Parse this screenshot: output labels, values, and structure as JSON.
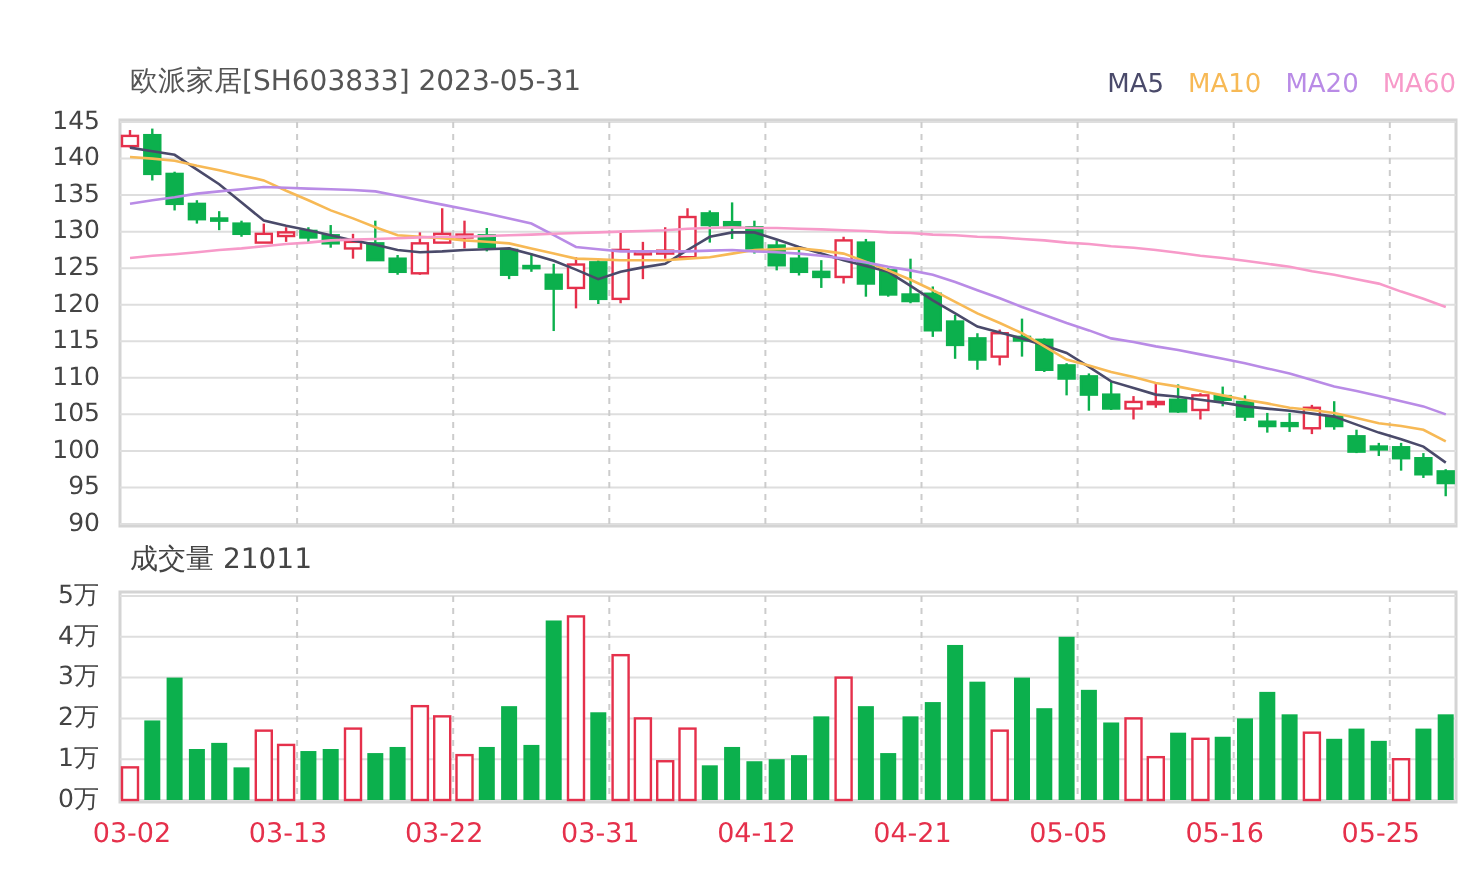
{
  "header": {
    "title": "欧派家居[SH603833] 2023-05-31"
  },
  "price_chart": {
    "candles": {
      "chart_data": {
        "type": "candlestick",
        "grid": true,
        "ylim": [
          90,
          145
        ],
        "yticks": [
          90,
          95,
          100,
          105,
          110,
          115,
          120,
          125,
          130,
          135,
          140,
          145
        ],
        "ohlc": [
          [
            141.7,
            143.9,
            141.5,
            143.1
          ],
          [
            143.2,
            144.1,
            137.0,
            137.9
          ],
          [
            137.9,
            138.2,
            132.9,
            133.8
          ],
          [
            133.8,
            134.3,
            131.1,
            131.7
          ],
          [
            131.8,
            132.8,
            130.2,
            131.5
          ],
          [
            131.1,
            131.5,
            129.3,
            129.7
          ],
          [
            128.5,
            131.1,
            128.5,
            129.7
          ],
          [
            129.4,
            130.6,
            128.6,
            129.9
          ],
          [
            130.1,
            130.6,
            128.5,
            129.2
          ],
          [
            129.5,
            130.9,
            127.8,
            128.4
          ],
          [
            127.7,
            129.7,
            126.3,
            128.6
          ],
          [
            128.4,
            131.5,
            126.1,
            126.1
          ],
          [
            126.3,
            126.8,
            124.1,
            124.5
          ],
          [
            124.3,
            129.9,
            124.1,
            128.4
          ],
          [
            128.5,
            133.2,
            128.5,
            129.7
          ],
          [
            129.2,
            131.5,
            127.7,
            129.6
          ],
          [
            129.5,
            130.5,
            127.3,
            127.9
          ],
          [
            127.5,
            127.9,
            123.5,
            124.1
          ],
          [
            125.3,
            127.0,
            124.5,
            125.0
          ],
          [
            124.1,
            125.6,
            116.4,
            122.2
          ],
          [
            122.3,
            126.5,
            119.5,
            125.5
          ],
          [
            125.8,
            126.1,
            120.1,
            120.8
          ],
          [
            120.8,
            130.1,
            120.2,
            127.5
          ],
          [
            126.9,
            128.6,
            123.5,
            127.3
          ],
          [
            127.0,
            130.6,
            126.3,
            127.4
          ],
          [
            126.5,
            133.2,
            126.3,
            132.0
          ],
          [
            132.5,
            132.9,
            128.5,
            130.9
          ],
          [
            131.3,
            134.0,
            129.0,
            130.6
          ],
          [
            130.6,
            131.5,
            127.0,
            127.7
          ],
          [
            128.1,
            128.8,
            124.7,
            125.4
          ],
          [
            126.3,
            127.9,
            124.0,
            124.5
          ],
          [
            124.5,
            126.1,
            122.3,
            123.8
          ],
          [
            123.8,
            129.3,
            122.9,
            128.8
          ],
          [
            128.5,
            129.0,
            121.1,
            122.9
          ],
          [
            124.7,
            125.0,
            121.1,
            121.4
          ],
          [
            121.4,
            126.3,
            120.2,
            120.5
          ],
          [
            121.5,
            122.5,
            115.6,
            116.5
          ],
          [
            117.7,
            118.6,
            112.6,
            114.5
          ],
          [
            115.4,
            116.1,
            111.1,
            112.5
          ],
          [
            112.9,
            116.6,
            111.7,
            116.1
          ],
          [
            115.6,
            118.1,
            112.9,
            115.1
          ],
          [
            115.2,
            115.4,
            110.8,
            111.1
          ],
          [
            111.7,
            112.0,
            107.6,
            109.9
          ],
          [
            110.2,
            110.6,
            105.5,
            107.7
          ],
          [
            107.7,
            109.5,
            105.6,
            105.8
          ],
          [
            105.8,
            107.5,
            104.3,
            106.7
          ],
          [
            106.4,
            109.3,
            105.9,
            106.7
          ],
          [
            107.0,
            109.1,
            105.2,
            105.4
          ],
          [
            105.6,
            107.9,
            104.3,
            107.6
          ],
          [
            107.5,
            108.8,
            106.1,
            107.0
          ],
          [
            106.7,
            107.6,
            104.1,
            104.7
          ],
          [
            104.0,
            105.2,
            102.5,
            103.4
          ],
          [
            103.8,
            105.2,
            102.6,
            103.4
          ],
          [
            103.1,
            106.3,
            102.3,
            105.9
          ],
          [
            104.7,
            106.8,
            102.9,
            103.4
          ],
          [
            102.0,
            102.9,
            99.7,
            99.9
          ],
          [
            100.6,
            101.1,
            99.3,
            100.2
          ],
          [
            100.5,
            101.1,
            97.3,
            99.0
          ],
          [
            99.0,
            99.7,
            96.3,
            96.8
          ],
          [
            97.2,
            97.5,
            93.8,
            95.6
          ]
        ]
      }
    },
    "moving_averages": {
      "chart_data": {
        "type": "line",
        "ylim": [
          90,
          145
        ],
        "series": [
          {
            "name": "MA5",
            "color": "#4a4a6a",
            "values": [
              141.5,
              141.0,
              140.5,
              138.5,
              136.5,
              134.0,
              131.5,
              130.8,
              130.2,
              129.5,
              128.8,
              128.2,
              127.5,
              127.2,
              127.3,
              127.5,
              127.6,
              127.7,
              126.9,
              126.0,
              124.8,
              123.5,
              124.5,
              125.1,
              125.6,
              127.5,
              129.3,
              129.9,
              129.9,
              128.9,
              127.9,
              127.0,
              126.1,
              125.3,
              124.5,
              122.6,
              120.6,
              118.8,
              117.0,
              116.2,
              115.4,
              114.4,
              113.4,
              111.5,
              109.5,
              108.6,
              107.7,
              107.4,
              107.0,
              106.6,
              106.1,
              105.8,
              105.5,
              105.1,
              104.7,
              103.6,
              102.5,
              101.6,
              100.6,
              98.4
            ]
          },
          {
            "name": "MA10",
            "color": "#f7b955",
            "values": [
              140.2,
              140.0,
              139.7,
              139.0,
              138.4,
              137.7,
              137.0,
              135.6,
              134.3,
              132.9,
              131.8,
              130.6,
              129.5,
              129.3,
              129.1,
              128.8,
              128.6,
              128.4,
              127.7,
              127.0,
              126.3,
              126.2,
              126.1,
              126.1,
              126.1,
              126.3,
              126.5,
              127.0,
              127.5,
              127.6,
              127.7,
              127.4,
              127.0,
              125.9,
              124.7,
              123.4,
              122.0,
              120.4,
              118.8,
              117.5,
              116.1,
              114.3,
              112.5,
              111.7,
              110.8,
              110.1,
              109.3,
              108.8,
              108.2,
              107.6,
              107.0,
              106.5,
              105.9,
              105.6,
              105.2,
              104.5,
              103.8,
              103.4,
              102.9,
              101.3
            ]
          },
          {
            "name": "MA20",
            "color": "#b98be6",
            "values": [
              133.8,
              134.3,
              134.7,
              135.2,
              135.5,
              135.8,
              136.1,
              136.0,
              135.9,
              135.8,
              135.7,
              135.5,
              134.9,
              134.3,
              133.7,
              133.1,
              132.5,
              131.8,
              131.1,
              129.5,
              127.9,
              127.6,
              127.3,
              127.3,
              127.3,
              127.3,
              127.4,
              127.5,
              127.3,
              127.2,
              127.0,
              126.7,
              126.3,
              125.8,
              125.2,
              124.7,
              124.1,
              123.1,
              122.0,
              120.9,
              119.7,
              118.6,
              117.5,
              116.5,
              115.4,
              114.9,
              114.3,
              113.8,
              113.2,
              112.6,
              112.0,
              111.3,
              110.6,
              109.7,
              108.8,
              108.2,
              107.5,
              106.8,
              106.1,
              105.0
            ]
          },
          {
            "name": "MA60",
            "color": "#f79ac9",
            "values": [
              126.4,
              126.7,
              126.9,
              127.2,
              127.5,
              127.7,
              128.0,
              128.3,
              128.5,
              128.8,
              128.9,
              129.0,
              129.1,
              129.2,
              129.3,
              129.3,
              129.4,
              129.5,
              129.6,
              129.7,
              129.8,
              129.9,
              130.0,
              130.1,
              130.2,
              130.4,
              130.5,
              130.6,
              130.5,
              130.5,
              130.4,
              130.3,
              130.2,
              130.1,
              129.9,
              129.8,
              129.6,
              129.5,
              129.3,
              129.2,
              129.0,
              128.8,
              128.5,
              128.3,
              128.0,
              127.8,
              127.5,
              127.1,
              126.7,
              126.4,
              126.0,
              125.6,
              125.2,
              124.6,
              124.1,
              123.5,
              122.9,
              121.8,
              120.8,
              119.7
            ]
          }
        ]
      }
    }
  },
  "volume_chart": {
    "title": "成交量 21011",
    "hollow": [
      true,
      false,
      false,
      false,
      false,
      false,
      true,
      true,
      false,
      false,
      true,
      false,
      false,
      true,
      true,
      true,
      false,
      false,
      false,
      false,
      true,
      false,
      true,
      true,
      true,
      true,
      false,
      false,
      false,
      false,
      false,
      false,
      true,
      false,
      false,
      false,
      false,
      false,
      false,
      true,
      false,
      false,
      false,
      false,
      false,
      true,
      true,
      false,
      true,
      false,
      false,
      false,
      false,
      true,
      false,
      false,
      false,
      true,
      false,
      false
    ],
    "chart_data": {
      "type": "bar",
      "grid": true,
      "ylim": [
        0,
        5
      ],
      "yticks": [
        {
          "value": 0,
          "label": "0万"
        },
        {
          "value": 1,
          "label": "1万"
        },
        {
          "value": 2,
          "label": "2万"
        },
        {
          "value": 3,
          "label": "3万"
        },
        {
          "value": 4,
          "label": "4万"
        },
        {
          "value": 5,
          "label": "5万"
        }
      ],
      "categories": [
        "03-02",
        null,
        null,
        null,
        null,
        null,
        null,
        "03-13",
        null,
        null,
        null,
        null,
        null,
        null,
        "03-22",
        null,
        null,
        null,
        null,
        null,
        null,
        "03-31",
        null,
        null,
        null,
        null,
        null,
        null,
        "04-12",
        null,
        null,
        null,
        null,
        null,
        null,
        "04-21",
        null,
        null,
        null,
        null,
        null,
        null,
        "05-05",
        null,
        null,
        null,
        null,
        null,
        null,
        "05-16",
        null,
        null,
        null,
        null,
        null,
        null,
        "05-25",
        null,
        null,
        null
      ],
      "values": [
        0.8,
        1.95,
        3.0,
        1.25,
        1.4,
        0.8,
        1.7,
        1.35,
        1.2,
        1.25,
        1.75,
        1.15,
        1.3,
        2.3,
        2.05,
        1.1,
        1.3,
        2.3,
        1.35,
        4.4,
        4.5,
        2.15,
        3.55,
        2.0,
        0.95,
        1.75,
        0.85,
        1.3,
        0.95,
        1.0,
        1.1,
        2.05,
        3.0,
        2.3,
        1.15,
        2.05,
        2.4,
        3.8,
        2.9,
        1.7,
        3.0,
        2.25,
        4.0,
        2.7,
        1.9,
        2.0,
        1.05,
        1.65,
        1.5,
        1.55,
        2.0,
        2.65,
        2.1,
        1.65,
        1.5,
        1.75,
        1.45,
        1.0,
        1.75,
        2.1
      ]
    }
  }
}
